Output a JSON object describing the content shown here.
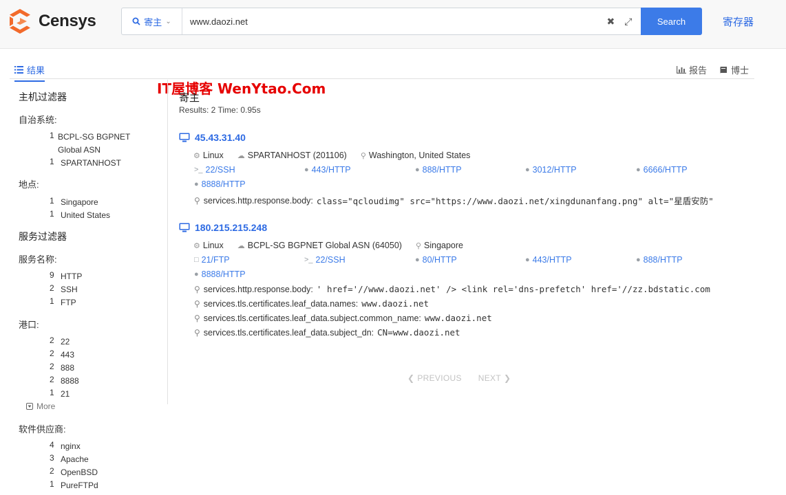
{
  "brand": {
    "name": "Censys",
    "colors": {
      "orange": "#f26a2b",
      "accent": "#2d6ae3"
    }
  },
  "search": {
    "scope": "寄主",
    "query": "www.daozi.net",
    "button": "Search",
    "clear_icon": "close-icon",
    "expand_icon": "expand-icon"
  },
  "header": {
    "register": "寄存器"
  },
  "tabs": {
    "results": "结果",
    "report": "报告",
    "docs": "博士"
  },
  "watermark": "IT屋博客  WenYtao.Com",
  "sidebar": {
    "host_filters": "主机过滤器",
    "asn_label": "自治系统:",
    "asn": [
      {
        "count": "1",
        "label": "BCPL-SG BGPNET Global ASN"
      },
      {
        "count": "1",
        "label": "SPARTANHOST"
      }
    ],
    "location_label": "地点:",
    "locations": [
      {
        "count": "1",
        "label": "Singapore"
      },
      {
        "count": "1",
        "label": "United States"
      }
    ],
    "service_filters": "服务过滤器",
    "service_name_label": "服务名称:",
    "service_names": [
      {
        "count": "9",
        "label": "HTTP"
      },
      {
        "count": "2",
        "label": "SSH"
      },
      {
        "count": "1",
        "label": "FTP"
      }
    ],
    "port_label": "港口:",
    "ports": [
      {
        "count": "2",
        "label": "22"
      },
      {
        "count": "2",
        "label": "443"
      },
      {
        "count": "2",
        "label": "888"
      },
      {
        "count": "2",
        "label": "8888"
      },
      {
        "count": "1",
        "label": "21"
      }
    ],
    "more": "More",
    "vendor_label": "软件供应商:",
    "vendors": [
      {
        "count": "4",
        "label": "nginx"
      },
      {
        "count": "3",
        "label": "Apache"
      },
      {
        "count": "2",
        "label": "OpenBSD"
      },
      {
        "count": "1",
        "label": "PureFTPd"
      }
    ]
  },
  "results": {
    "title": "寄主",
    "stats": "Results: 2   Time: 0.95s",
    "hosts": [
      {
        "ip": "45.43.31.40",
        "os": "Linux",
        "asn": "SPARTANHOST (201106)",
        "location": "Washington, United States",
        "services": [
          "22/SSH",
          "443/HTTP",
          "888/HTTP",
          "3012/HTTP",
          "6666/HTTP",
          "8888/HTTP"
        ],
        "hits": [
          {
            "field": "services.http.response.body:",
            "value": "class=\"qcloudimg\" src=\"https://www.daozi.net/xingdunanfang.png\" alt=\"星盾安防\""
          }
        ]
      },
      {
        "ip": "180.215.215.248",
        "os": "Linux",
        "asn": "BCPL-SG BGPNET Global ASN (64050)",
        "location": "Singapore",
        "services": [
          "21/FTP",
          "22/SSH",
          "80/HTTP",
          "443/HTTP",
          "888/HTTP",
          "8888/HTTP"
        ],
        "hits": [
          {
            "field": "services.http.response.body:",
            "value": "' href='//www.daozi.net' /> <link rel='dns-prefetch' href='//zz.bdstatic.com"
          },
          {
            "field": "services.tls.certificates.leaf_data.names:",
            "value": "www.daozi.net"
          },
          {
            "field": "services.tls.certificates.leaf_data.subject.common_name:",
            "value": "www.daozi.net"
          },
          {
            "field": "services.tls.certificates.leaf_data.subject_dn:",
            "value": "CN=www.daozi.net"
          }
        ]
      }
    ]
  },
  "pager": {
    "previous": "PREVIOUS",
    "next": "NEXT"
  }
}
